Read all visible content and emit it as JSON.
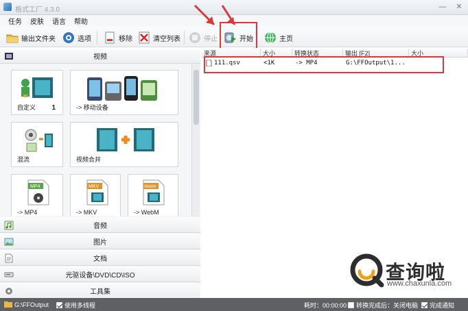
{
  "window": {
    "title": "格式工厂 4.3.0",
    "minimize": "—",
    "close": "✕"
  },
  "menu": [
    "任务",
    "皮肤",
    "语言",
    "帮助"
  ],
  "toolbar": {
    "output_folder": "输出文件夹",
    "options": "选项",
    "remove": "移除",
    "clear_list": "清空列表",
    "stop": "停止",
    "start": "开始",
    "home": "主页"
  },
  "panel": {
    "video_header": "视频",
    "tiles": [
      {
        "label": "自定义",
        "count": "1"
      },
      {
        "label": "-> 移动设备"
      },
      {
        "label": "混流"
      },
      {
        "label": "视频合并"
      },
      {
        "label": "-> MP4",
        "badge": "MP4"
      },
      {
        "label": "-> MKV",
        "badge": "MKV"
      },
      {
        "label": "-> WebM",
        "badge": "WebM"
      }
    ],
    "sections": [
      "音频",
      "图片",
      "文档",
      "光驱设备\\DVD\\CD\\ISO",
      "工具集"
    ]
  },
  "table": {
    "headers": [
      "来源",
      "大小",
      "转换状态",
      "输出 [F2]",
      "大小"
    ],
    "rows": [
      {
        "source": "111.qsv",
        "size": "<1K",
        "status": "-> MP4",
        "output": "G:\\FFOutput\\1..."
      }
    ]
  },
  "status": {
    "folder": "G:\\FFOutput",
    "multithread": "使用多线程",
    "elapsed": "耗时：00:00:00",
    "after_convert": "转换完成后：关闭电脑",
    "notify": "完成通知"
  },
  "watermark": {
    "text": "查询啦",
    "url": "www.chaxunla.com"
  },
  "colors": {
    "highlight": "#d63a3a",
    "statusbar": "#5f6064"
  }
}
